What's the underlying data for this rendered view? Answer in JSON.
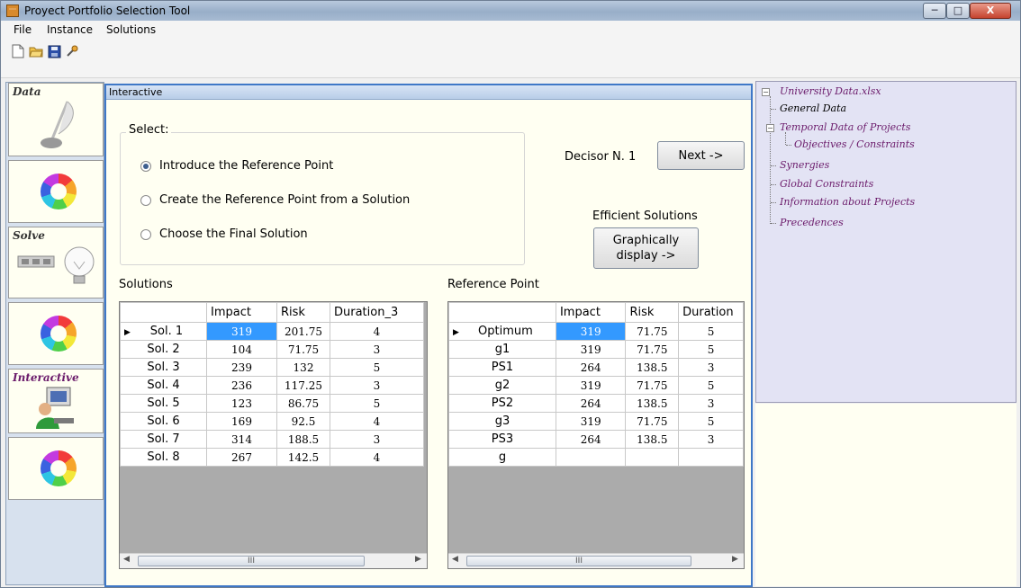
{
  "window": {
    "title": "Proyect Portfolio Selection Tool"
  },
  "menu": [
    "File",
    "Instance",
    "Solutions"
  ],
  "toolbar": {
    "icons": [
      "new-file-icon",
      "open-folder-icon",
      "save-icon",
      "wrench-icon"
    ]
  },
  "left_nav": [
    {
      "label": "Data",
      "icon": "quill-inkwell-icon"
    },
    {
      "label": "",
      "icon": "color-wheel-icon"
    },
    {
      "label": "Solve",
      "icon": "lightbulb-icon"
    },
    {
      "label": "",
      "icon": "color-wheel-icon"
    },
    {
      "label": "Interactive",
      "icon": "computer-user-icon"
    },
    {
      "label": "",
      "icon": "color-wheel-icon"
    }
  ],
  "panel": {
    "title": "Interactive"
  },
  "select": {
    "title": "Select:",
    "options": [
      {
        "label": "Introduce the Reference Point",
        "selected": true
      },
      {
        "label": "Create the Reference Point from a Solution",
        "selected": false
      },
      {
        "label": "Choose the Final Solution",
        "selected": false
      }
    ]
  },
  "decisor": {
    "label": "Decisor N. 1",
    "next_label": "Next ->"
  },
  "efficient": {
    "label": "Efficient Solutions",
    "button_line1": "Graphically",
    "button_line2": "display ->"
  },
  "solutions": {
    "title": "Solutions",
    "columns": [
      "",
      "Impact",
      "Risk",
      "Duration_3"
    ],
    "rows": [
      {
        "name": "Sol. 1",
        "impact": "319",
        "risk": "201.75",
        "duration": "4"
      },
      {
        "name": "Sol. 2",
        "impact": "104",
        "risk": "71.75",
        "duration": "3"
      },
      {
        "name": "Sol. 3",
        "impact": "239",
        "risk": "132",
        "duration": "5"
      },
      {
        "name": "Sol. 4",
        "impact": "236",
        "risk": "117.25",
        "duration": "3"
      },
      {
        "name": "Sol. 5",
        "impact": "123",
        "risk": "86.75",
        "duration": "5"
      },
      {
        "name": "Sol. 6",
        "impact": "169",
        "risk": "92.5",
        "duration": "4"
      },
      {
        "name": "Sol. 7",
        "impact": "314",
        "risk": "188.5",
        "duration": "3"
      },
      {
        "name": "Sol. 8",
        "impact": "267",
        "risk": "142.5",
        "duration": "4"
      }
    ]
  },
  "reference": {
    "title": "Reference Point",
    "columns": [
      "",
      "Impact",
      "Risk",
      "Duration"
    ],
    "rows": [
      {
        "name": "Optimum",
        "impact": "319",
        "risk": "71.75",
        "duration": "5"
      },
      {
        "name": "g1",
        "impact": "319",
        "risk": "71.75",
        "duration": "5"
      },
      {
        "name": "PS1",
        "impact": "264",
        "risk": "138.5",
        "duration": "3"
      },
      {
        "name": "g2",
        "impact": "319",
        "risk": "71.75",
        "duration": "5"
      },
      {
        "name": "PS2",
        "impact": "264",
        "risk": "138.5",
        "duration": "3"
      },
      {
        "name": "g3",
        "impact": "319",
        "risk": "71.75",
        "duration": "5"
      },
      {
        "name": "PS3",
        "impact": "264",
        "risk": "138.5",
        "duration": "3"
      },
      {
        "name": "g",
        "impact": "",
        "risk": "",
        "duration": ""
      }
    ]
  },
  "scrollbar": {
    "grip": "III"
  },
  "tree": {
    "root": "University Data.xlsx",
    "general": "General Data",
    "temporal": "Temporal Data of Projects",
    "objectives": "Objectives / Constraints",
    "synergies": "Synergies",
    "global": "Global Constraints",
    "info": "Information about Projects",
    "precedences": "Precedences"
  },
  "colors": {
    "selection": "#3399ff",
    "panel_bg": "#fffff2",
    "tree_bg": "#e3e3f4",
    "tree_text": "#6b1b6b",
    "accent_border": "#3f78c7"
  }
}
